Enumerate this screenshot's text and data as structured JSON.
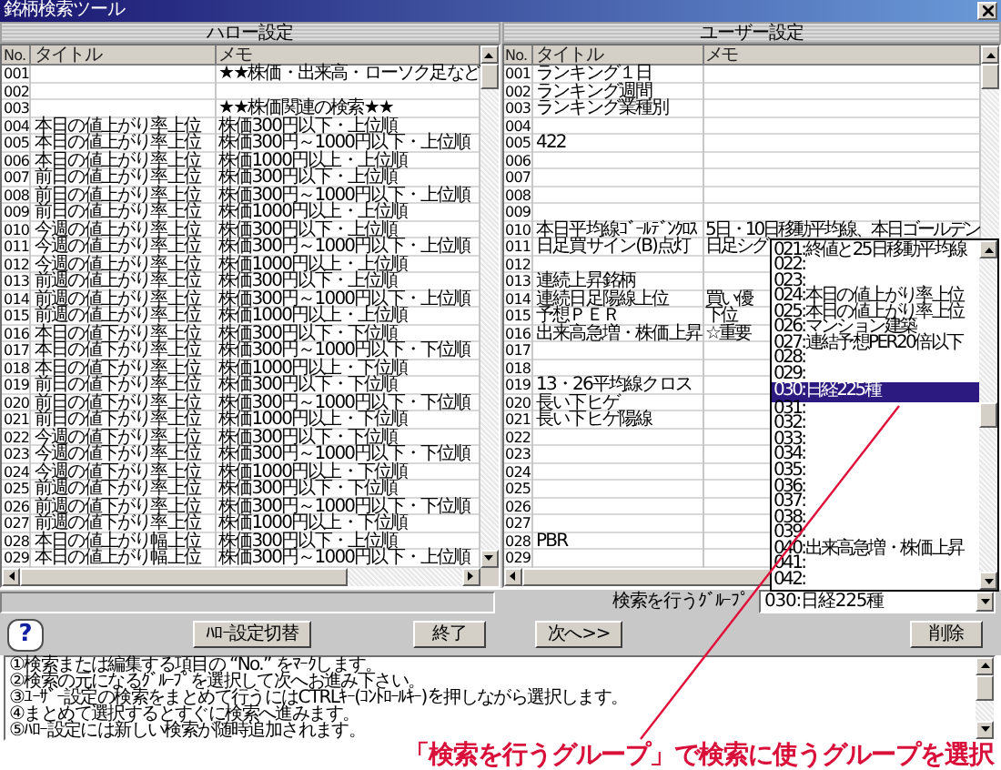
{
  "window": {
    "title": "銘柄検索ツール"
  },
  "panels": [
    {
      "header": "ハロー設定",
      "columns": [
        "No.",
        "タイトル",
        "メモ"
      ],
      "rows": [
        {
          "no": "001",
          "memo": "★★株価・出来高・ローソク足など"
        },
        {
          "no": "002"
        },
        {
          "no": "003",
          "memo": "★★株価関連の検索★★"
        },
        {
          "no": "004",
          "title": "本日の値上がり率上位",
          "memo": "株価300円以下・上位順"
        },
        {
          "no": "005",
          "title": "本日の値上がり率上位",
          "memo": "株価300円～1000円以下・上位順"
        },
        {
          "no": "006",
          "title": "本日の値上がり率上位",
          "memo": "株価1000円以上・上位順"
        },
        {
          "no": "007",
          "title": "前日の値上がり率上位",
          "memo": "株価300円以下・上位順"
        },
        {
          "no": "008",
          "title": "前日の値上がり率上位",
          "memo": "株価300円～1000円以下・上位順"
        },
        {
          "no": "009",
          "title": "前日の値上がり率上位",
          "memo": "株価1000円以上・上位順"
        },
        {
          "no": "010",
          "title": "今週の値上がり率上位",
          "memo": "株価300円以下・上位順"
        },
        {
          "no": "011",
          "title": "今週の値上がり率上位",
          "memo": "株価300円～1000円以下・上位順"
        },
        {
          "no": "012",
          "title": "今週の値上がり率上位",
          "memo": "株価1000円以上・上位順"
        },
        {
          "no": "013",
          "title": "前週の値上がり率上位",
          "memo": "株価300円以下・上位順"
        },
        {
          "no": "014",
          "title": "前週の値上がり率上位",
          "memo": "株価300円～1000円以下・上位順"
        },
        {
          "no": "015",
          "title": "前週の値上がり率上位",
          "memo": "株価1000円以上・上位順"
        },
        {
          "no": "016",
          "title": "本日の値下がり率上位",
          "memo": "株価300円以下・下位順"
        },
        {
          "no": "017",
          "title": "本日の値下がり率上位",
          "memo": "株価300円～1000円以下・下位順"
        },
        {
          "no": "018",
          "title": "本日の値下がり率上位",
          "memo": "株価1000円以上・下位順"
        },
        {
          "no": "019",
          "title": "前日の値下がり率上位",
          "memo": "株価300円以下・下位順"
        },
        {
          "no": "020",
          "title": "前日の値下がり率上位",
          "memo": "株価300円～1000円以下・下位順"
        },
        {
          "no": "021",
          "title": "前日の値下がり率上位",
          "memo": "株価1000円以上・下位順"
        },
        {
          "no": "022",
          "title": "今週の値下がり率上位",
          "memo": "株価300円以下・下位順"
        },
        {
          "no": "023",
          "title": "今週の値下がり率上位",
          "memo": "株価300円～1000円以下・下位順"
        },
        {
          "no": "024",
          "title": "今週の値下がり率上位",
          "memo": "株価1000円以上・下位順"
        },
        {
          "no": "025",
          "title": "前週の値下がり率上位",
          "memo": "株価300円以下・下位順"
        },
        {
          "no": "026",
          "title": "前週の値下がり率上位",
          "memo": "株価300円～1000円以下・下位順"
        },
        {
          "no": "027",
          "title": "前週の値下がり率上位",
          "memo": "株価1000円以上・下位順"
        },
        {
          "no": "028",
          "title": "本日の値上がり幅上位",
          "memo": "株価300円以下・上位順"
        },
        {
          "no": "029",
          "title": "本日の値上がり幅上位",
          "memo": "株価300円～1000円以下・上位順"
        }
      ]
    },
    {
      "header": "ユーザー設定",
      "columns": [
        "No.",
        "タイトル",
        "メモ"
      ],
      "rows": [
        {
          "no": "001",
          "title": "ランキング１日"
        },
        {
          "no": "002",
          "title": "ランキング週間"
        },
        {
          "no": "003",
          "title": "ランキング業種別"
        },
        {
          "no": "004"
        },
        {
          "no": "005",
          "title": "422"
        },
        {
          "no": "006"
        },
        {
          "no": "007"
        },
        {
          "no": "008"
        },
        {
          "no": "009"
        },
        {
          "no": "010",
          "title": "本日平均線ｺﾞｰﾙﾃﾞﾝｸﾛｽ",
          "memo": "5日・10日移動平均線、本日ゴールデン"
        },
        {
          "no": "011",
          "title": "日足買サイン(B)点灯",
          "memo": "日足シグ"
        },
        {
          "no": "012"
        },
        {
          "no": "013",
          "title": "連続上昇銘柄"
        },
        {
          "no": "014",
          "title": "連続日足陽線上位",
          "memo": "買い優"
        },
        {
          "no": "015",
          "title": "予想ＰＥＲ",
          "memo": "下位"
        },
        {
          "no": "016",
          "title": "出来高急増・株価上昇",
          "memo": "☆重要"
        },
        {
          "no": "017"
        },
        {
          "no": "018"
        },
        {
          "no": "019",
          "title": "13・26平均線クロス"
        },
        {
          "no": "020",
          "title": "長い下ヒゲ"
        },
        {
          "no": "021",
          "title": "長い下ヒゲ陽線"
        },
        {
          "no": "022"
        },
        {
          "no": "023"
        },
        {
          "no": "024"
        },
        {
          "no": "025"
        },
        {
          "no": "026"
        },
        {
          "no": "027"
        },
        {
          "no": "028",
          "title": "PBR"
        },
        {
          "no": "029"
        }
      ]
    }
  ],
  "group_dropdown": {
    "items": [
      {
        "text": "021:終値と25日移動平均線",
        "selected": false
      },
      {
        "text": "022:",
        "selected": false
      },
      {
        "text": "023:",
        "selected": false
      },
      {
        "text": "024:本日の値上がり率上位",
        "selected": false
      },
      {
        "text": "025:本日の値上がり率上位",
        "selected": false
      },
      {
        "text": "026:マンション建築",
        "selected": false
      },
      {
        "text": "027:連結予想PER20倍以下",
        "selected": false
      },
      {
        "text": "028:",
        "selected": false
      },
      {
        "text": "029:",
        "selected": false
      },
      {
        "text": "030:日経225種",
        "selected": true
      },
      {
        "text": "031:",
        "selected": false
      },
      {
        "text": "032:",
        "selected": false
      },
      {
        "text": "033:",
        "selected": false
      },
      {
        "text": "034:",
        "selected": false
      },
      {
        "text": "035:",
        "selected": false
      },
      {
        "text": "036:",
        "selected": false
      },
      {
        "text": "037:",
        "selected": false
      },
      {
        "text": "038:",
        "selected": false
      },
      {
        "text": "039:",
        "selected": false
      },
      {
        "text": "040:出来高急増・株価上昇",
        "selected": false
      },
      {
        "text": "041:",
        "selected": false
      },
      {
        "text": "042:",
        "selected": false
      }
    ]
  },
  "group_select": {
    "label": "検索を行うｸﾞﾙｰﾌﾟ",
    "value": "030:日経225種"
  },
  "help_button": {
    "glyph": "?"
  },
  "buttons": [
    "ﾊﾛｰ設定切替",
    "終了",
    "次へ>>",
    "削除"
  ],
  "help_lines": [
    "①検索または編集する項目の “No.” をﾏｰｸします。",
    "②検索の元になるｸﾞﾙｰﾌﾟを選択して次へお進み下さい。",
    "③ﾕｰｻﾞｰ設定の検索をまとめて行うにはCTRLｷｰ(ｺﾝﾄﾛｰﾙｷｰ)を押しながら選択します。",
    "④まとめて選択するとすぐに検索へ進みます。",
    "⑤ﾊﾛｰ設定には新しい検索が随時追加されます。"
  ],
  "annotation": "「検索を行うグループ」で検索に使うグループを選択"
}
